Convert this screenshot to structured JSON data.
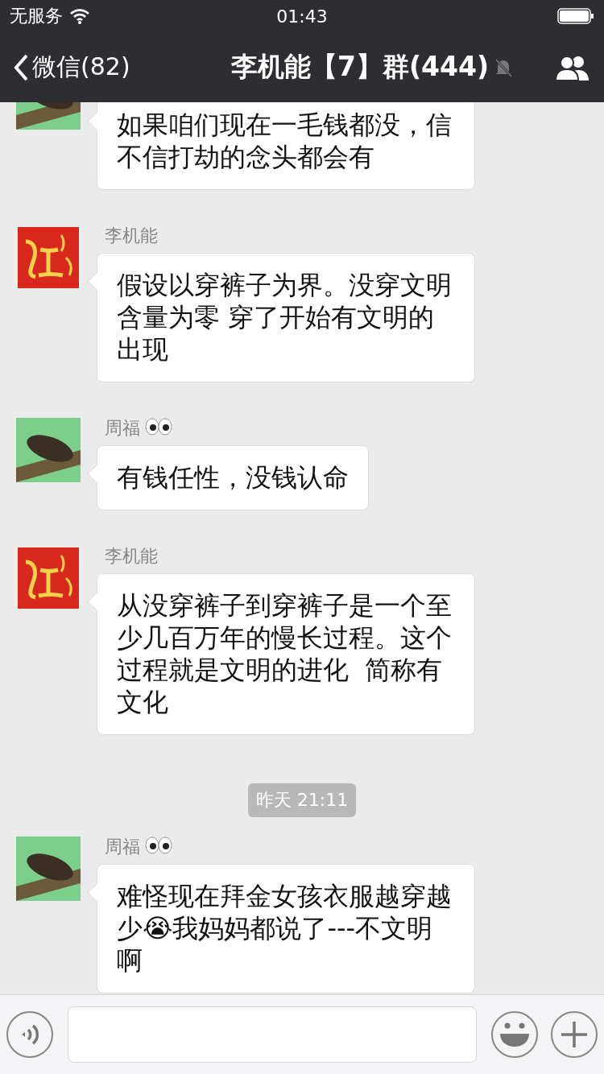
{
  "status_bar": {
    "carrier": "无服务",
    "time": "01:43"
  },
  "nav": {
    "back_label": "微信(82)",
    "title": "李机能【7】群(444)",
    "muted": true
  },
  "messages": [
    {
      "kind": "message",
      "avatar": {
        "kind": "photo"
      },
      "text": "如果咱们现在一毛钱都没，信不信打劫的念头都会有"
    },
    {
      "kind": "message",
      "sender": "李机能",
      "avatar": {
        "kind": "logo"
      },
      "text": "假设以穿裤子为界。没穿文明含量为零 穿了开始有文明的出现"
    },
    {
      "kind": "message",
      "sender": "周福",
      "name_icon": {
        "kind": "eyes"
      },
      "avatar": {
        "kind": "photo"
      },
      "text": "有钱任性，没钱认命"
    },
    {
      "kind": "message",
      "sender": "李机能",
      "avatar": {
        "kind": "logo"
      },
      "text": "从没穿裤子到穿裤子是一个至少几百万年的慢长过程。这个过程就是文明的进化  简称有文化"
    },
    {
      "kind": "time",
      "text": "昨天 21:11"
    },
    {
      "kind": "message",
      "sender": "周福",
      "name_icon": {
        "kind": "eyes"
      },
      "avatar": {
        "kind": "photo"
      },
      "text": "难怪现在拜金女孩衣服越穿越少😭我妈妈都说了---不文明啊"
    }
  ]
}
